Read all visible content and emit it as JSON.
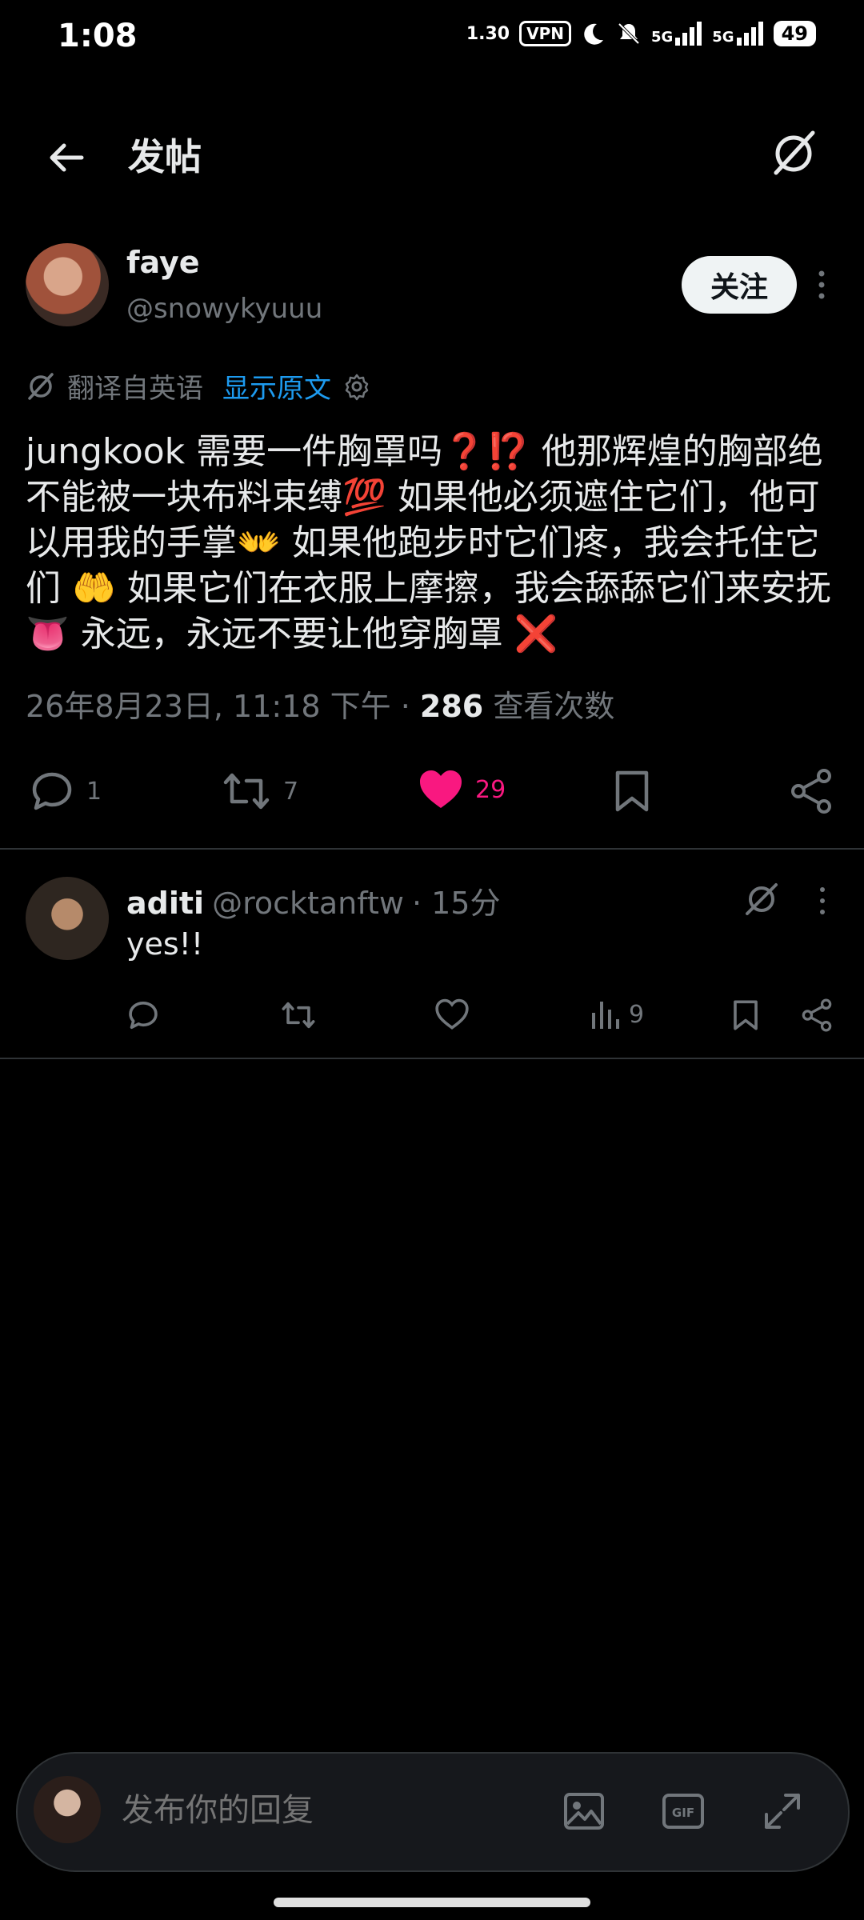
{
  "status_bar": {
    "time": "1:08",
    "speed": "1.30",
    "vpn": "VPN",
    "net1": "5G",
    "net2": "5G",
    "battery": "49"
  },
  "header": {
    "title": "发帖"
  },
  "post": {
    "author_name": "faye",
    "author_handle": "@snowykyuuu",
    "follow_label": "关注",
    "translated_from": "翻译自英语",
    "show_original": "显示原文",
    "text": "jungkook 需要一件胸罩吗❓⁉️ 他那辉煌的胸部绝不能被一块布料束缚💯 如果他必须遮住它们，他可以用我的手掌👐 如果他跑步时它们疼，我会托住它们 🤲 如果它们在衣服上摩擦，我会舔舔它们来安抚👅 永远，永远不要让他穿胸罩 ❌",
    "timestamp": "26年8月23日, 11:18 下午",
    "dot": "·",
    "views_count": "286",
    "views_label": "查看次数",
    "reply_count": "1",
    "retweet_count": "7",
    "like_count": "29"
  },
  "reply": {
    "name": "aditi",
    "handle": "@rocktanftw",
    "time": "· 15分",
    "text": "yes!!",
    "views_count": "9"
  },
  "composer": {
    "placeholder": "发布你的回复"
  },
  "colors": {
    "accent": "#1d9bf0",
    "like": "#f91880",
    "muted": "#71767b",
    "bg": "#000000"
  }
}
